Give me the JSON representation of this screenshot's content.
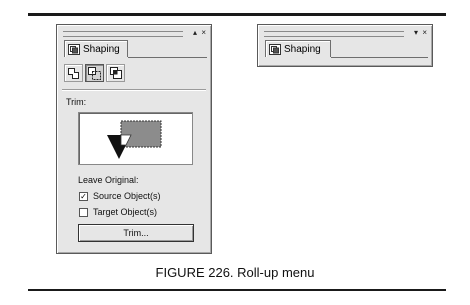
{
  "docker_expanded": {
    "tab_label": "Shaping",
    "titlebar_buttons": [
      "▴",
      "×"
    ],
    "section_label": "Trim:",
    "leave_original_label": "Leave Original:",
    "checkboxes": [
      {
        "label": "Source Object(s)",
        "checked": true
      },
      {
        "label": "Target Object(s)",
        "checked": false
      }
    ],
    "action_button": "Trim..."
  },
  "docker_rolled": {
    "tab_label": "Shaping",
    "titlebar_buttons": [
      "▾",
      "×"
    ]
  },
  "caption": "FIGURE 226. Roll-up menu",
  "colors": {
    "panel_bg": "#e6e6e6",
    "preview_fill": "#8c8c8c",
    "trim_shape": "#111111"
  }
}
